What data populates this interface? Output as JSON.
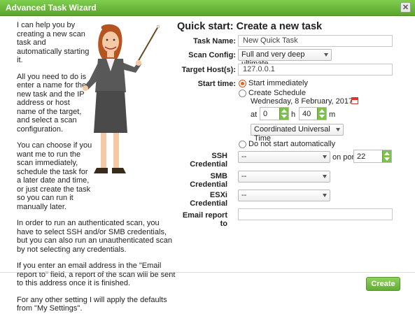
{
  "window": {
    "title": "Advanced Task Wizard",
    "close_glyph": "✕"
  },
  "intro": {
    "paragraphs": [
      "I can help you by creating a new scan task and automatically starting it.",
      "All you need to do is enter a name for the new task and the IP address or host name of the target, and select a scan configuration.",
      "You can choose if you want me to run the scan immediately, schedule the task for a later date and time, or just create the task so you can run it manually later.",
      "In order to run an authenticated scan, you have to select SSH and/or SMB credentials, but you can also run an unauthenticated scan by not selecting any credentials.",
      "If you enter an email address in the \"Email report to\" field, a report of the scan will be sent to this address once it is finished.",
      "For any other setting I will apply the defaults from \"My Settings\"."
    ]
  },
  "form": {
    "title": "Quick start: Create a new task",
    "task_name": {
      "label": "Task Name:",
      "value": "New Quick Task"
    },
    "scan_config": {
      "label": "Scan Config:",
      "value": "Full and very deep ultimate"
    },
    "target_hosts": {
      "label": "Target Host(s):",
      "value": "127.0.0.1"
    },
    "start_time": {
      "label": "Start time:",
      "immediately": "Start immediately",
      "schedule": "Create Schedule",
      "date": "Wednesday, 8 February, 2017",
      "at_label": "at",
      "hour": "0",
      "h_label": "h",
      "minute": "40",
      "m_label": "m",
      "timezone": "Coordinated Universal Time",
      "no_start": "Do not start automatically",
      "selected": "immediately"
    },
    "ssh": {
      "label_1": "SSH",
      "label_2": "Credential",
      "value": "--",
      "port_label": "on port",
      "port": "22"
    },
    "smb": {
      "label_1": "SMB",
      "label_2": "Credential",
      "value": "--"
    },
    "esxi": {
      "label_1": "ESXi",
      "label_2": "Credential",
      "value": "--"
    },
    "email": {
      "label": "Email report to",
      "value": ""
    }
  },
  "footer": {
    "create_label": "Create"
  },
  "colors": {
    "accent": "#66b538",
    "radio_selected": "#e2612b"
  },
  "icons": {
    "close": "close-icon",
    "calendar": "calendar-icon",
    "mascot": "assistant-figure"
  }
}
